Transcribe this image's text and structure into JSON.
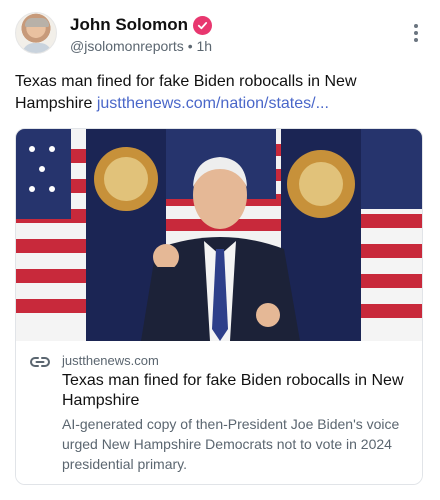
{
  "author": {
    "name": "John Solomon",
    "handle": "@jsolomonreports",
    "separator": "•",
    "time": "1h",
    "verified_color": "#e8376f"
  },
  "post": {
    "text": "Texas man fined for fake Biden robocalls in New Hampshire",
    "link_text": "justthenews.com/nation/states/..."
  },
  "card": {
    "domain": "justthenews.com",
    "title": "Texas man fined for fake Biden robocalls in New Hampshire",
    "description": "AI-generated copy of then-President Joe Biden's voice urged New Hampshire Democrats not to vote in 2024 presidential primary."
  },
  "icons": [
    "verified-badge-icon",
    "more-options-icon",
    "link-icon"
  ],
  "colors": {
    "link": "#4a67c9",
    "muted": "#5b6670",
    "border": "#e1e4e8"
  }
}
